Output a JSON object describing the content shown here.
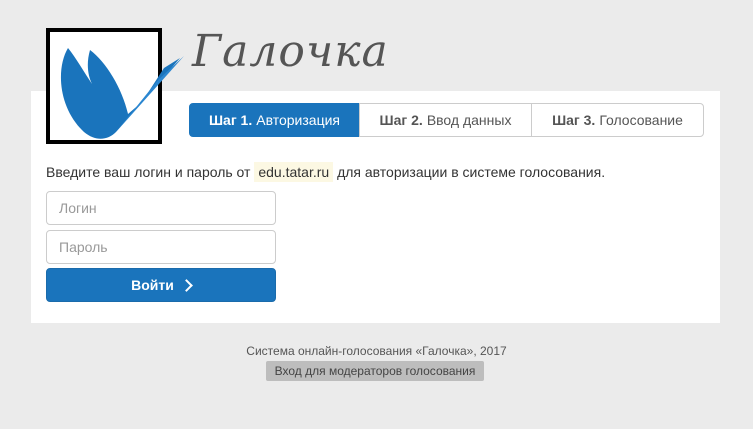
{
  "brand": {
    "title": "Галочка",
    "logo_icon": "bird-checkmark-icon"
  },
  "steps": [
    {
      "num": "Шаг 1.",
      "label": "Авторизация",
      "active": true
    },
    {
      "num": "Шаг 2.",
      "label": "Ввод данных",
      "active": false
    },
    {
      "num": "Шаг 3.",
      "label": "Голосование",
      "active": false
    }
  ],
  "intro": {
    "before": "Введите ваш логин и пароль от",
    "highlight": "edu.tatar.ru",
    "after": "для авторизации в системе голосования."
  },
  "form": {
    "login_placeholder": "Логин",
    "login_value": "",
    "password_placeholder": "Пароль",
    "password_value": "",
    "submit_label": "Войти"
  },
  "footer": {
    "copyright": "Система онлайн-голосования «Галочка», 2017",
    "moderator_link": "Вход для модераторов голосования"
  },
  "colors": {
    "accent": "#1a74bc",
    "background": "#ebebeb",
    "highlight": "#fcf8e3"
  }
}
